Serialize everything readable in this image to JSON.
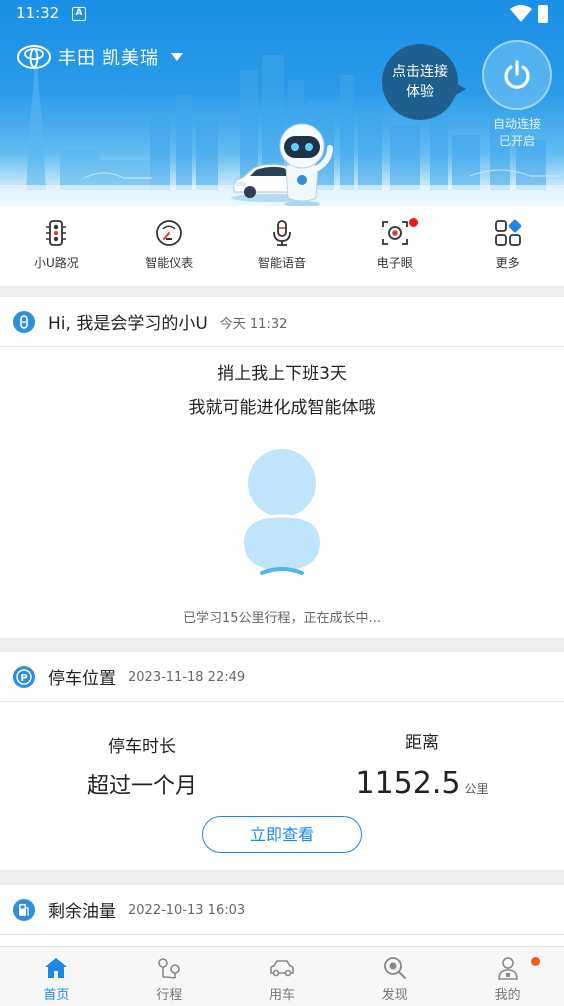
{
  "status_bar": {
    "time": "11:32",
    "notification_badge": "A"
  },
  "header": {
    "brand": "丰田",
    "model": "凯美瑞",
    "connect_bubble": [
      "点击连接",
      "体验"
    ],
    "auto_connect": [
      "自动连接",
      "已开启"
    ]
  },
  "quick_menu": [
    {
      "label": "小U路况",
      "icon": "traffic-light-icon"
    },
    {
      "label": "智能仪表",
      "icon": "gauge-icon"
    },
    {
      "label": "智能语音",
      "icon": "microphone-icon"
    },
    {
      "label": "电子眼",
      "icon": "camera-eye-icon",
      "badge": true
    },
    {
      "label": "更多",
      "icon": "grid-more-icon"
    }
  ],
  "xiaou_card": {
    "title": "Hi, 我是会学习的小U",
    "time": "今天 11:32",
    "message_line1": "捎上我上下班3天",
    "message_line2": "我就可能进化成智能体哦",
    "progress": "已学习15公里行程，正在成长中..."
  },
  "parking_card": {
    "title": "停车位置",
    "time": "2023-11-18 22:49",
    "duration_label": "停车时长",
    "duration_value": "超过一个月",
    "distance_label": "距离",
    "distance_value": "1152.5",
    "distance_unit": "公里",
    "button": "立即查看"
  },
  "fuel_card": {
    "title": "剩余油量",
    "time": "2022-10-13 16:03"
  },
  "tab_bar": [
    {
      "label": "首页",
      "icon": "home-icon",
      "active": true
    },
    {
      "label": "行程",
      "icon": "route-icon"
    },
    {
      "label": "用车",
      "icon": "car-icon"
    },
    {
      "label": "发现",
      "icon": "discover-icon"
    },
    {
      "label": "我的",
      "icon": "profile-icon",
      "badge": true
    }
  ],
  "colors": {
    "accent": "#1e88e5",
    "hero_top": "#1a8fe6",
    "badge_red": "#f01a1a",
    "badge_orange": "#f45a1f",
    "bubble": "#1f5f8f"
  }
}
